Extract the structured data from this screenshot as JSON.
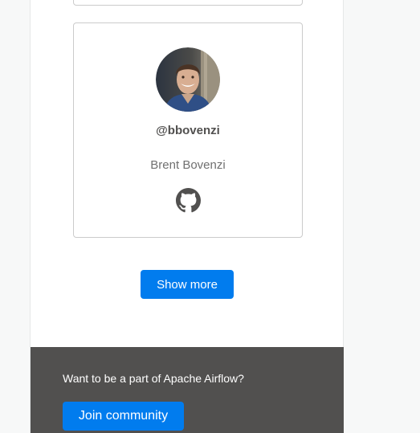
{
  "committer": {
    "handle": "@bbovenzi",
    "name": "Brent Bovenzi",
    "avatar_icon": "user-avatar-photo",
    "link_icon": "github-icon"
  },
  "actions": {
    "show_more_label": "Show more"
  },
  "footer": {
    "prompt": "Want to be a part of Apache Airflow?",
    "join_label": "Join community"
  },
  "colors": {
    "accent": "#017cee",
    "footer_bg": "#51504f",
    "card_border": "#cbcbcb",
    "page_bg": "#f7f8f8"
  }
}
